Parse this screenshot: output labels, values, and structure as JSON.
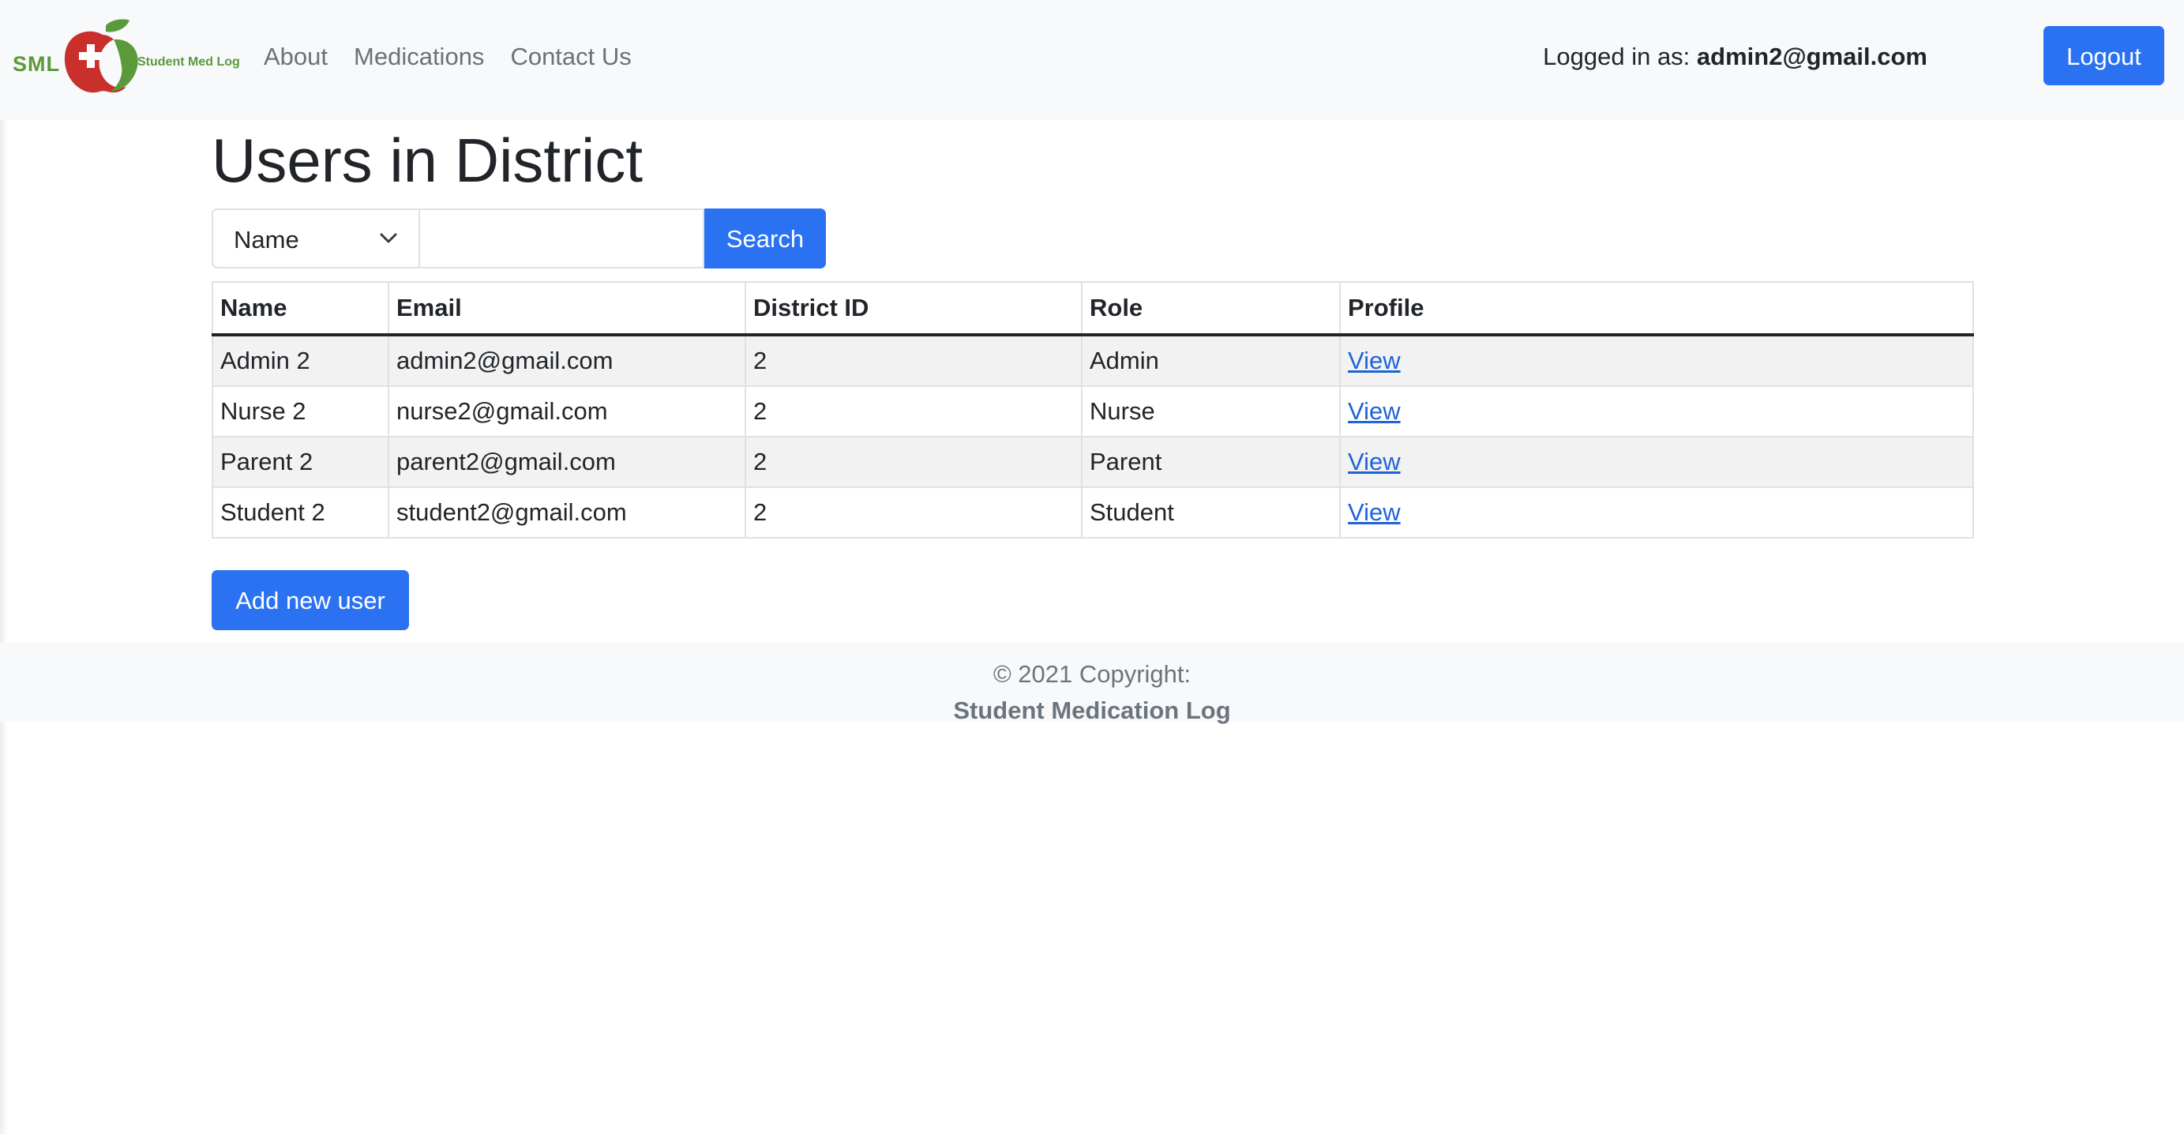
{
  "navbar": {
    "brand_short": "SML",
    "brand_tagline": "Student Med Log",
    "links": [
      "About",
      "Medications",
      "Contact Us"
    ],
    "logged_in_prefix": "Logged in as:",
    "logged_in_user": "admin2@gmail.com",
    "logout_label": "Logout"
  },
  "main": {
    "title": "Users in District",
    "search": {
      "field_selected": "Name",
      "query_value": "",
      "button_label": "Search"
    },
    "table": {
      "columns": [
        "Name",
        "Email",
        "District ID",
        "Role",
        "Profile"
      ],
      "rows": [
        [
          "Admin 2",
          "admin2@gmail.com",
          "2",
          "Admin",
          "View"
        ],
        [
          "Nurse 2",
          "nurse2@gmail.com",
          "2",
          "Nurse",
          "View"
        ],
        [
          "Parent 2",
          "parent2@gmail.com",
          "2",
          "Parent",
          "View"
        ],
        [
          "Student 2",
          "student2@gmail.com",
          "2",
          "Student",
          "View"
        ]
      ]
    },
    "add_user_label": "Add new user"
  },
  "footer": {
    "copyright": "© 2021 Copyright:",
    "org_name": "Student Medication Log"
  },
  "colors": {
    "primary": "#2a72f2",
    "navbar_bg": "#f8f9fa",
    "brand_green": "#5a9a3a",
    "brand_red": "#c9302c"
  }
}
